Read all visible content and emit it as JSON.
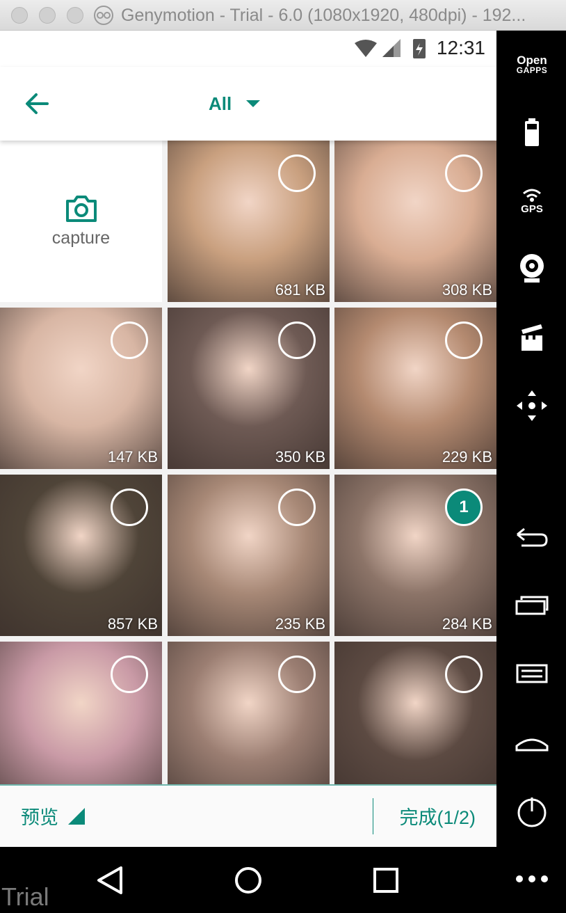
{
  "window": {
    "title": "Genymotion - Trial - 6.0 (1080x1920, 480dpi) - 192..."
  },
  "statusbar": {
    "time": "12:31"
  },
  "appbar": {
    "album_label": "All"
  },
  "capture": {
    "label": "capture"
  },
  "photos": [
    {
      "size": "681 KB",
      "selected": false,
      "color": "#c9a07f"
    },
    {
      "size": "308 KB",
      "selected": false,
      "color": "#d9ad93"
    },
    {
      "size": "147 KB",
      "selected": false,
      "color": "#d8b6a4"
    },
    {
      "size": "350 KB",
      "selected": false,
      "color": "#6e5a54"
    },
    {
      "size": "229 KB",
      "selected": false,
      "color": "#b48a70"
    },
    {
      "size": "857 KB",
      "selected": false,
      "color": "#4f4438"
    },
    {
      "size": "235 KB",
      "selected": false,
      "color": "#a78876"
    },
    {
      "size": "284 KB",
      "selected": true,
      "badge": "1",
      "color": "#8c7468"
    },
    {
      "size": "",
      "selected": false,
      "color": "#c99aa6"
    },
    {
      "size": "",
      "selected": false,
      "color": "#9b7e72"
    },
    {
      "size": "",
      "selected": false,
      "color": "#5c4a42"
    }
  ],
  "bottombar": {
    "preview_label": "预览",
    "done_label": "完成(1/2)"
  },
  "sidepanel": {
    "opengapps_line1": "Open",
    "opengapps_line2": "GAPPS",
    "gps_label": "GPS"
  },
  "watermark": "Trial",
  "colors": {
    "accent": "#0b8a79"
  }
}
